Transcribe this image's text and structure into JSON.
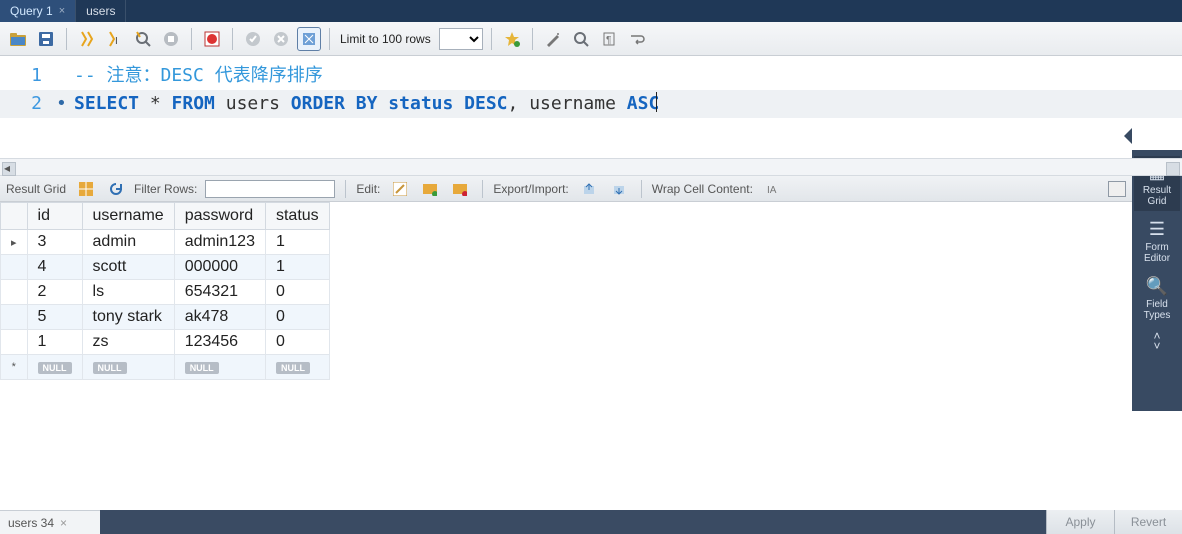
{
  "tabs": [
    {
      "label": "Query 1",
      "active": true,
      "closable": true
    },
    {
      "label": "users",
      "active": false,
      "closable": false
    }
  ],
  "toolbar": {
    "limit_label": "Limit to 100 rows"
  },
  "editor": {
    "lines": [
      {
        "num": "1",
        "mark": "",
        "comment": "-- 注意：DESC 代表降序排序"
      },
      {
        "num": "2",
        "mark": "•"
      }
    ],
    "sql": {
      "kw_select": "SELECT",
      "star": " * ",
      "kw_from": "FROM",
      "tbl": " users ",
      "kw_order": "ORDER BY",
      "col1": " status ",
      "kw_desc": "DESC",
      "comma": ", ",
      "col2": "username ",
      "kw_asc": "ASC"
    }
  },
  "result_bar": {
    "label_grid": "Result Grid",
    "label_filter": "Filter Rows:",
    "label_edit": "Edit:",
    "label_export": "Export/Import:",
    "label_wrap": "Wrap Cell Content:"
  },
  "grid": {
    "columns": [
      "id",
      "username",
      "password",
      "status"
    ],
    "rows": [
      {
        "id": "3",
        "username": "admin",
        "password": "admin123",
        "status": "1"
      },
      {
        "id": "4",
        "username": "scott",
        "password": "000000",
        "status": "1"
      },
      {
        "id": "2",
        "username": "ls",
        "password": "654321",
        "status": "0"
      },
      {
        "id": "5",
        "username": "tony stark",
        "password": "ak478",
        "status": "0"
      },
      {
        "id": "1",
        "username": "zs",
        "password": "123456",
        "status": "0"
      }
    ],
    "null_label": "NULL",
    "row_marker_current": "▸",
    "row_marker_new": "*"
  },
  "side_panel": {
    "result_grid": "Result\nGrid",
    "form_editor": "Form\nEditor",
    "field_types": "Field\nTypes"
  },
  "bottom": {
    "tab_label": "users 34",
    "apply": "Apply",
    "revert": "Revert"
  }
}
